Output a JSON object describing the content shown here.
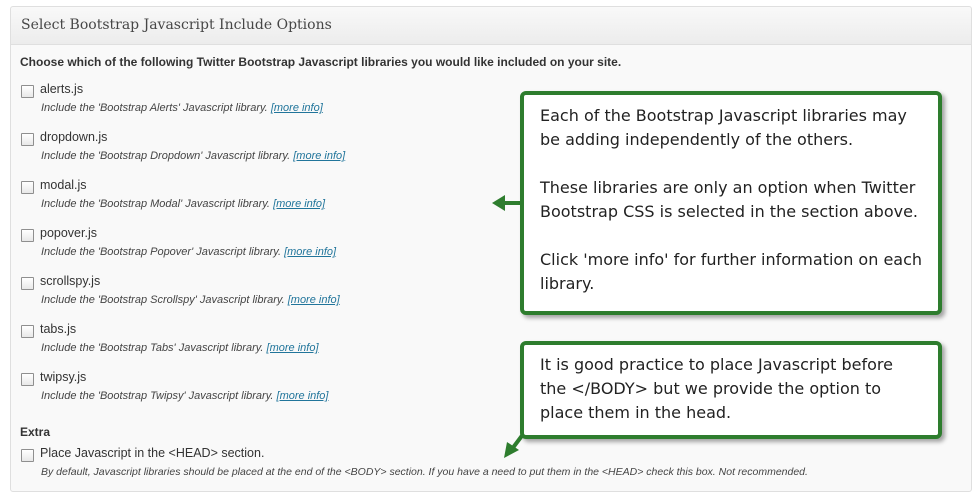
{
  "panel": {
    "title": "Select Bootstrap Javascript Include Options",
    "intro": "Choose which of the following Twitter Bootstrap Javascript libraries you would like included on your site."
  },
  "options": [
    {
      "label": "alerts.js",
      "desc": "Include the 'Bootstrap Alerts' Javascript library.",
      "link": "[more info]",
      "checked": false
    },
    {
      "label": "dropdown.js",
      "desc": "Include the 'Bootstrap Dropdown' Javascript library.",
      "link": "[more info]",
      "checked": false
    },
    {
      "label": "modal.js",
      "desc": "Include the 'Bootstrap Modal' Javascript library.",
      "link": "[more info]",
      "checked": false
    },
    {
      "label": "popover.js",
      "desc": "Include the 'Bootstrap Popover' Javascript library.",
      "link": "[more info]",
      "checked": false
    },
    {
      "label": "scrollspy.js",
      "desc": "Include the 'Bootstrap Scrollspy' Javascript library.",
      "link": "[more info]",
      "checked": false
    },
    {
      "label": "tabs.js",
      "desc": "Include the 'Bootstrap Tabs' Javascript library.",
      "link": "[more info]",
      "checked": false
    },
    {
      "label": "twipsy.js",
      "desc": "Include the 'Bootstrap Twipsy' Javascript library.",
      "link": "[more info]",
      "checked": false
    }
  ],
  "extra": {
    "heading": "Extra",
    "label": "Place Javascript in the <HEAD> section.",
    "desc": "By default, Javascript libraries should be placed at the end of the <BODY> section. If you have a need to put them in the <HEAD> check this box. Not recommended.",
    "checked": false
  },
  "callouts": {
    "c1_p1": "Each of the Bootstrap Javascript libraries may be adding independently of the others.",
    "c1_p2": "These libraries are only an option when Twitter Bootstrap CSS is selected in the section above.",
    "c1_p3": "Click 'more info' for further information on each library.",
    "c2_p1": "It is good practice to place Javascript before the </BODY> but we provide the option to place them in the head."
  },
  "colors": {
    "callout_border": "#2e7d2e",
    "link": "#21759b"
  }
}
